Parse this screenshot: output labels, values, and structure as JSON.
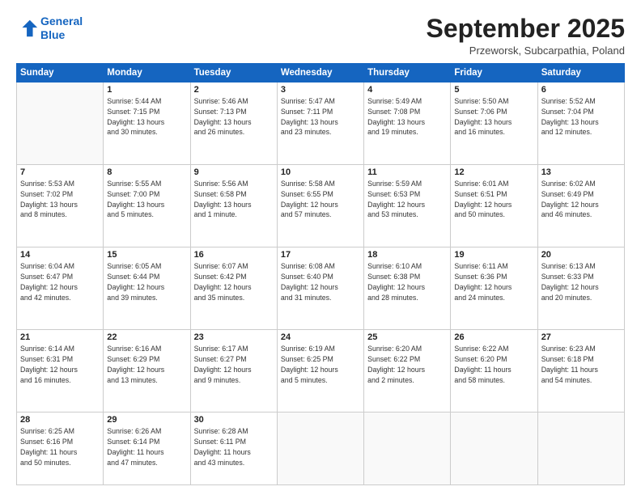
{
  "header": {
    "logo_line1": "General",
    "logo_line2": "Blue",
    "month": "September 2025",
    "location": "Przeworsk, Subcarpathia, Poland"
  },
  "weekdays": [
    "Sunday",
    "Monday",
    "Tuesday",
    "Wednesday",
    "Thursday",
    "Friday",
    "Saturday"
  ],
  "weeks": [
    [
      {
        "day": "",
        "info": ""
      },
      {
        "day": "1",
        "info": "Sunrise: 5:44 AM\nSunset: 7:15 PM\nDaylight: 13 hours\nand 30 minutes."
      },
      {
        "day": "2",
        "info": "Sunrise: 5:46 AM\nSunset: 7:13 PM\nDaylight: 13 hours\nand 26 minutes."
      },
      {
        "day": "3",
        "info": "Sunrise: 5:47 AM\nSunset: 7:11 PM\nDaylight: 13 hours\nand 23 minutes."
      },
      {
        "day": "4",
        "info": "Sunrise: 5:49 AM\nSunset: 7:08 PM\nDaylight: 13 hours\nand 19 minutes."
      },
      {
        "day": "5",
        "info": "Sunrise: 5:50 AM\nSunset: 7:06 PM\nDaylight: 13 hours\nand 16 minutes."
      },
      {
        "day": "6",
        "info": "Sunrise: 5:52 AM\nSunset: 7:04 PM\nDaylight: 13 hours\nand 12 minutes."
      }
    ],
    [
      {
        "day": "7",
        "info": "Sunrise: 5:53 AM\nSunset: 7:02 PM\nDaylight: 13 hours\nand 8 minutes."
      },
      {
        "day": "8",
        "info": "Sunrise: 5:55 AM\nSunset: 7:00 PM\nDaylight: 13 hours\nand 5 minutes."
      },
      {
        "day": "9",
        "info": "Sunrise: 5:56 AM\nSunset: 6:58 PM\nDaylight: 13 hours\nand 1 minute."
      },
      {
        "day": "10",
        "info": "Sunrise: 5:58 AM\nSunset: 6:55 PM\nDaylight: 12 hours\nand 57 minutes."
      },
      {
        "day": "11",
        "info": "Sunrise: 5:59 AM\nSunset: 6:53 PM\nDaylight: 12 hours\nand 53 minutes."
      },
      {
        "day": "12",
        "info": "Sunrise: 6:01 AM\nSunset: 6:51 PM\nDaylight: 12 hours\nand 50 minutes."
      },
      {
        "day": "13",
        "info": "Sunrise: 6:02 AM\nSunset: 6:49 PM\nDaylight: 12 hours\nand 46 minutes."
      }
    ],
    [
      {
        "day": "14",
        "info": "Sunrise: 6:04 AM\nSunset: 6:47 PM\nDaylight: 12 hours\nand 42 minutes."
      },
      {
        "day": "15",
        "info": "Sunrise: 6:05 AM\nSunset: 6:44 PM\nDaylight: 12 hours\nand 39 minutes."
      },
      {
        "day": "16",
        "info": "Sunrise: 6:07 AM\nSunset: 6:42 PM\nDaylight: 12 hours\nand 35 minutes."
      },
      {
        "day": "17",
        "info": "Sunrise: 6:08 AM\nSunset: 6:40 PM\nDaylight: 12 hours\nand 31 minutes."
      },
      {
        "day": "18",
        "info": "Sunrise: 6:10 AM\nSunset: 6:38 PM\nDaylight: 12 hours\nand 28 minutes."
      },
      {
        "day": "19",
        "info": "Sunrise: 6:11 AM\nSunset: 6:36 PM\nDaylight: 12 hours\nand 24 minutes."
      },
      {
        "day": "20",
        "info": "Sunrise: 6:13 AM\nSunset: 6:33 PM\nDaylight: 12 hours\nand 20 minutes."
      }
    ],
    [
      {
        "day": "21",
        "info": "Sunrise: 6:14 AM\nSunset: 6:31 PM\nDaylight: 12 hours\nand 16 minutes."
      },
      {
        "day": "22",
        "info": "Sunrise: 6:16 AM\nSunset: 6:29 PM\nDaylight: 12 hours\nand 13 minutes."
      },
      {
        "day": "23",
        "info": "Sunrise: 6:17 AM\nSunset: 6:27 PM\nDaylight: 12 hours\nand 9 minutes."
      },
      {
        "day": "24",
        "info": "Sunrise: 6:19 AM\nSunset: 6:25 PM\nDaylight: 12 hours\nand 5 minutes."
      },
      {
        "day": "25",
        "info": "Sunrise: 6:20 AM\nSunset: 6:22 PM\nDaylight: 12 hours\nand 2 minutes."
      },
      {
        "day": "26",
        "info": "Sunrise: 6:22 AM\nSunset: 6:20 PM\nDaylight: 11 hours\nand 58 minutes."
      },
      {
        "day": "27",
        "info": "Sunrise: 6:23 AM\nSunset: 6:18 PM\nDaylight: 11 hours\nand 54 minutes."
      }
    ],
    [
      {
        "day": "28",
        "info": "Sunrise: 6:25 AM\nSunset: 6:16 PM\nDaylight: 11 hours\nand 50 minutes."
      },
      {
        "day": "29",
        "info": "Sunrise: 6:26 AM\nSunset: 6:14 PM\nDaylight: 11 hours\nand 47 minutes."
      },
      {
        "day": "30",
        "info": "Sunrise: 6:28 AM\nSunset: 6:11 PM\nDaylight: 11 hours\nand 43 minutes."
      },
      {
        "day": "",
        "info": ""
      },
      {
        "day": "",
        "info": ""
      },
      {
        "day": "",
        "info": ""
      },
      {
        "day": "",
        "info": ""
      }
    ]
  ]
}
